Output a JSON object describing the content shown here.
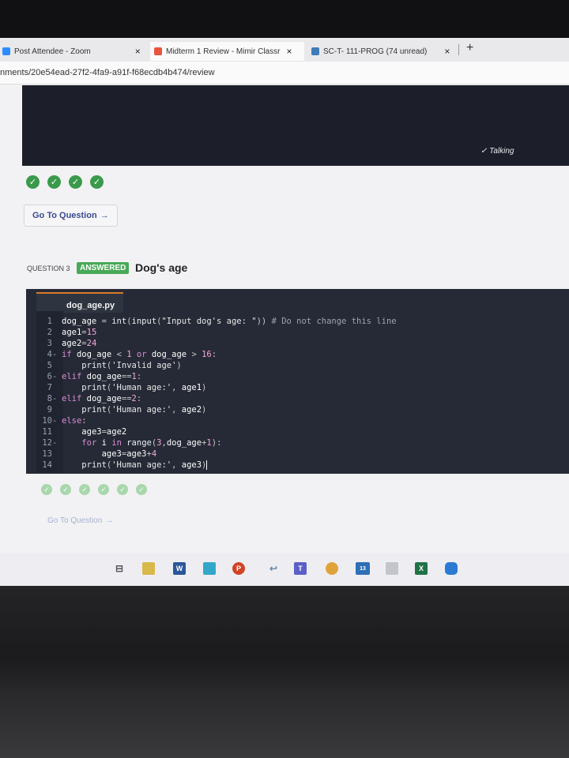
{
  "browser": {
    "tabs": [
      {
        "label": "Post Attendee - Zoom",
        "close": "×"
      },
      {
        "label": "Midterm 1 Review - Mimir Classr",
        "close": "×"
      },
      {
        "label": "SC-T- 111-PROG (74 unread)",
        "close": "×"
      }
    ],
    "new_tab": "+",
    "url": "nments/20e54ead-27f2-4fa9-a91f-f68ecdb4b474/review"
  },
  "video": {
    "status": "Talking"
  },
  "previous_question": {
    "goto_label": "Go To Question",
    "arrow": "→"
  },
  "question": {
    "label": "QUESTION 3",
    "status": "ANSWERED",
    "title": "Dog's age",
    "filename": "dog_age.py",
    "code_lines": [
      {
        "n": "1",
        "text": "dog_age = int(input(\"Input dog's age: \")) # Do not change this line"
      },
      {
        "n": "2",
        "text": "age1=15"
      },
      {
        "n": "3",
        "text": "age2=24"
      },
      {
        "n": "4",
        "text": "if dog_age < 1 or dog_age > 16:"
      },
      {
        "n": "5",
        "text": "    print('Invalid age')"
      },
      {
        "n": "6",
        "text": "elif dog_age==1:"
      },
      {
        "n": "7",
        "text": "    print('Human age:', age1)"
      },
      {
        "n": "8",
        "text": "elif dog_age==2:"
      },
      {
        "n": "9",
        "text": "    print('Human age:', age2)"
      },
      {
        "n": "10",
        "text": "else:"
      },
      {
        "n": "11",
        "text": "    age3=age2"
      },
      {
        "n": "12",
        "text": "    for i in range(3,dog_age+1):"
      },
      {
        "n": "13",
        "text": "        age3=age3+4"
      },
      {
        "n": "14",
        "text": "    print('Human age:', age3)"
      }
    ]
  },
  "next_section": {
    "goto_label": "Go To Question",
    "arrow": "→"
  },
  "taskbar": {
    "badge": "13"
  },
  "colors": {
    "accent": "#3a4a8e",
    "answered": "#48a957",
    "editor_bg": "#262a36",
    "check": "#3a9a4b"
  }
}
